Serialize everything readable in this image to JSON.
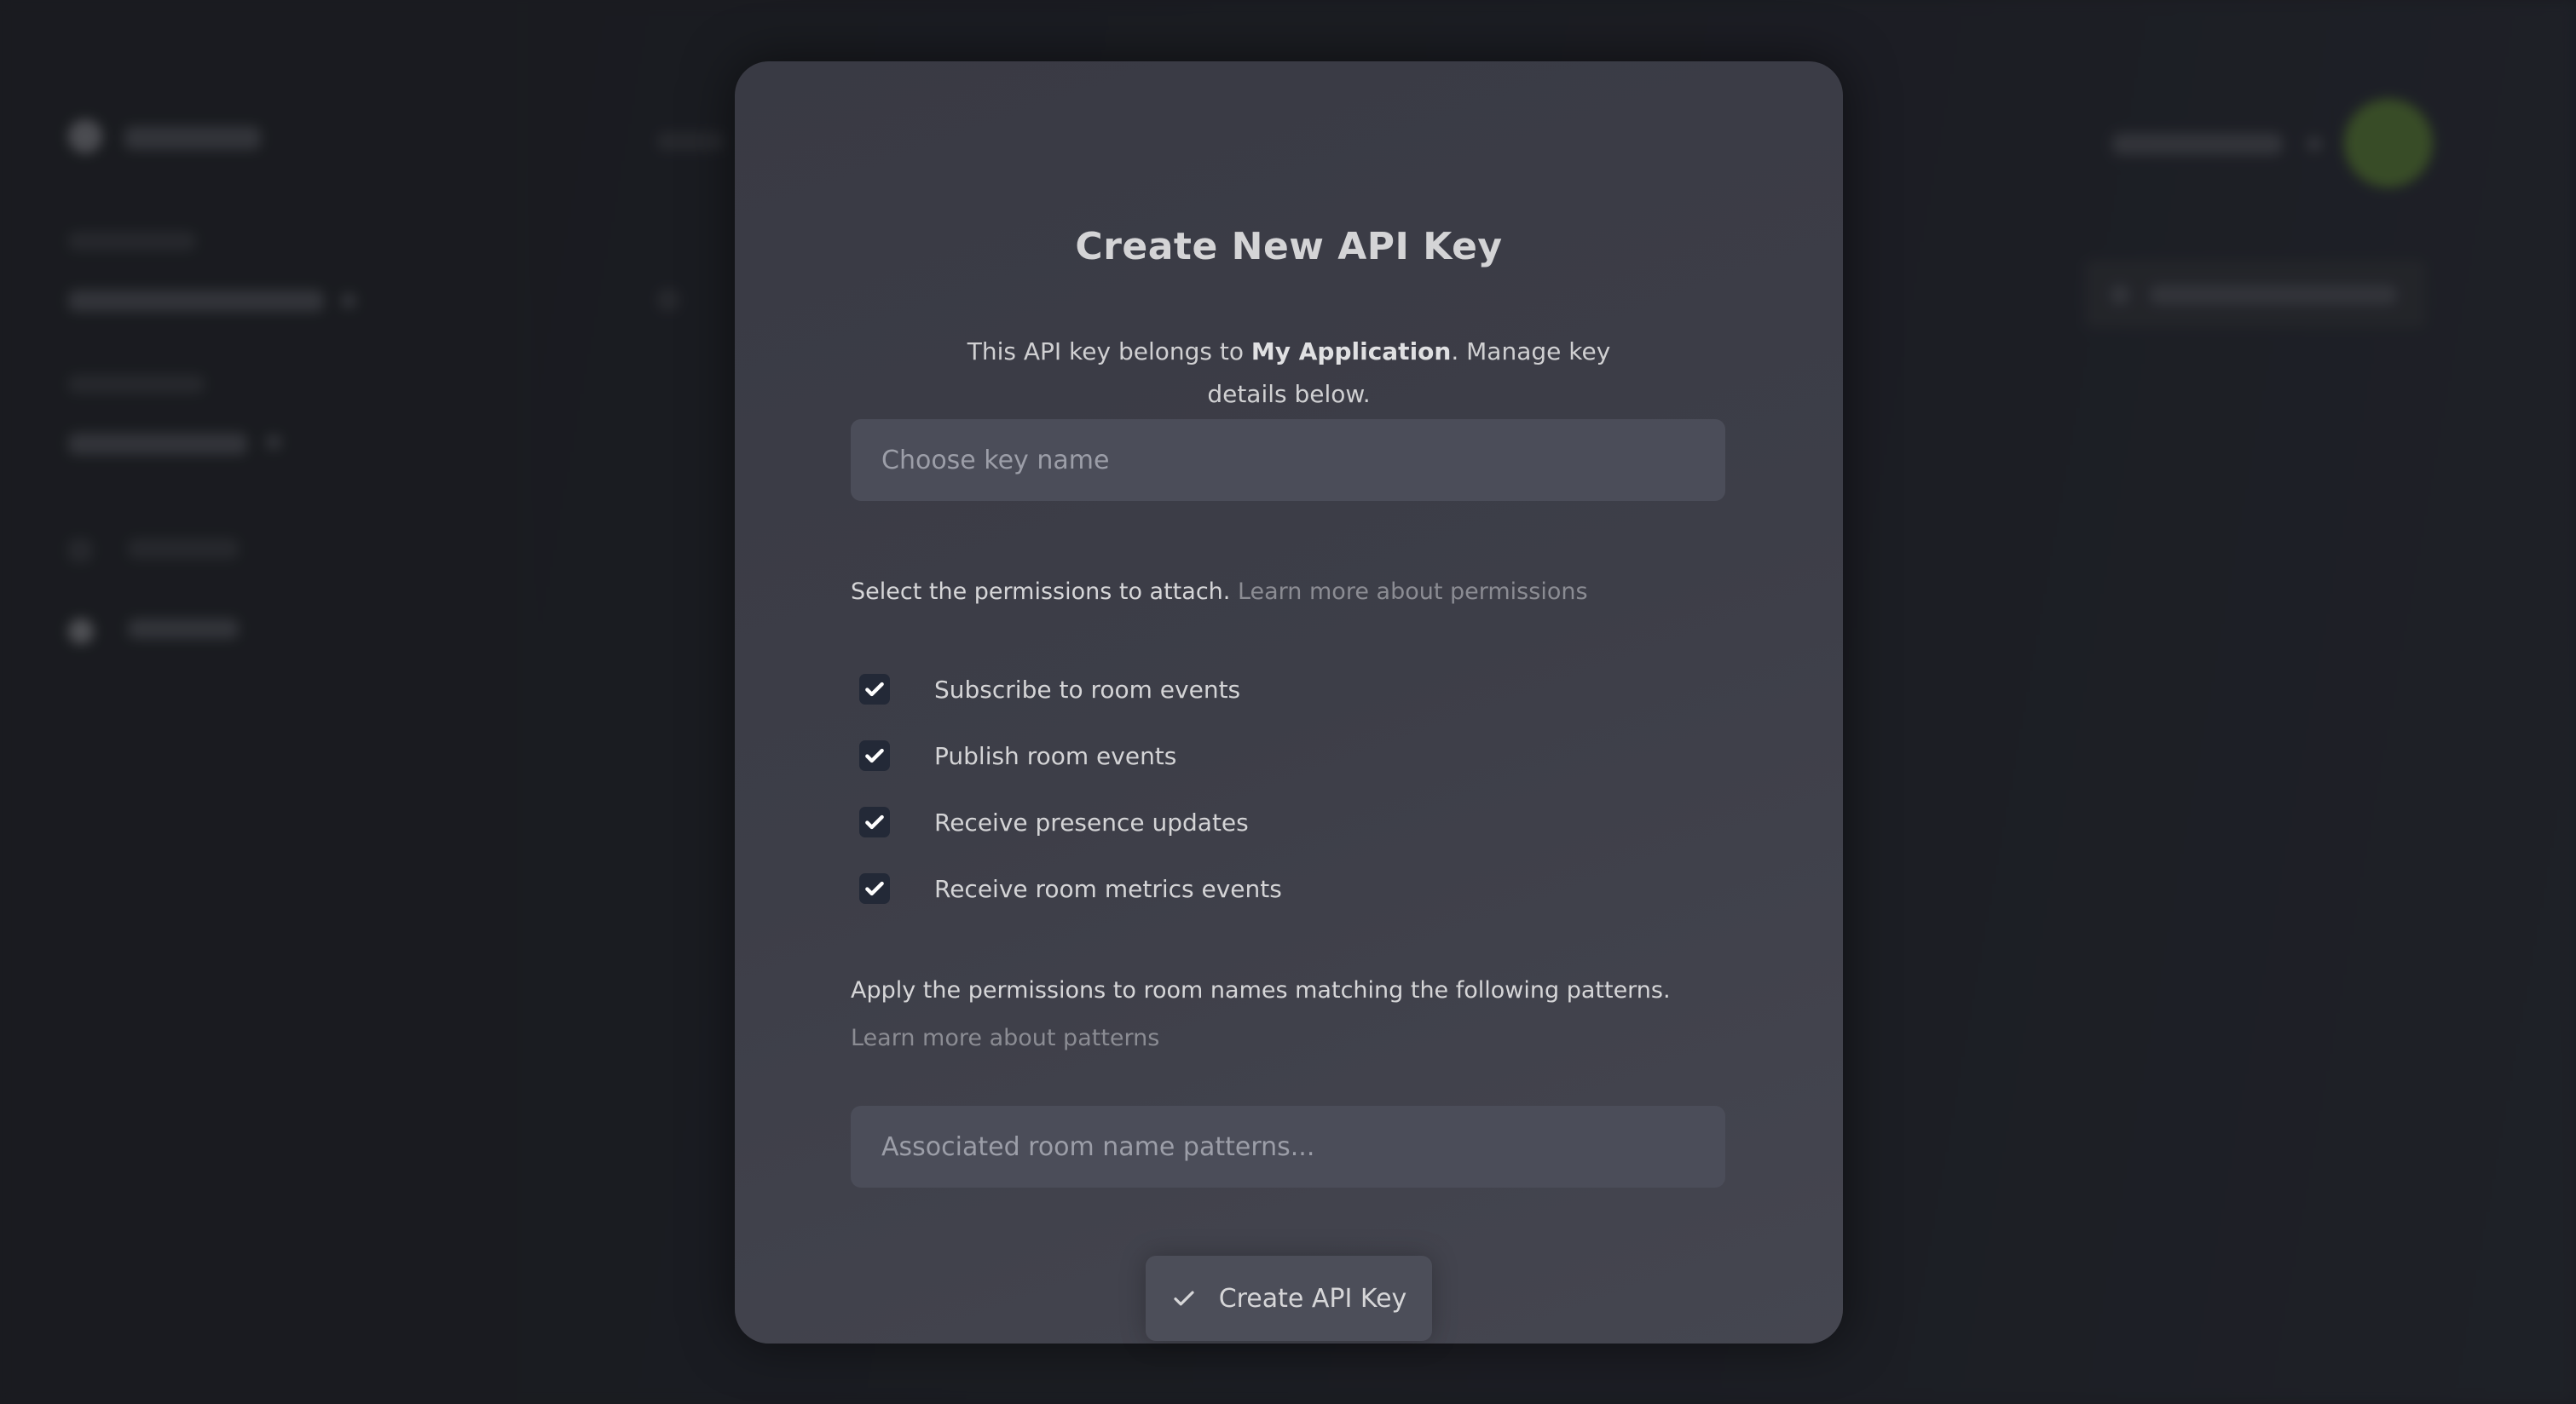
{
  "modal": {
    "title": "Create New API Key",
    "subtitle_prefix": "This API key belongs to ",
    "subtitle_app_name": "My Application",
    "subtitle_suffix": ". Manage key details below.",
    "key_name_placeholder": "Choose key name",
    "key_name_value": "",
    "permissions_intro": "Select the permissions to attach.",
    "permissions_link": "Learn more about permissions",
    "permissions": [
      {
        "label": "Subscribe to room events",
        "checked": true
      },
      {
        "label": "Publish room events",
        "checked": true
      },
      {
        "label": "Receive presence updates",
        "checked": true
      },
      {
        "label": "Receive room metrics events",
        "checked": true
      }
    ],
    "patterns_intro": "Apply the permissions to room names matching the following patterns.",
    "patterns_link": "Learn more about patterns",
    "patterns_placeholder": "Associated room name patterns...",
    "patterns_value": "",
    "submit_label": "Create API Key",
    "submit_icon": "check-icon"
  },
  "colors": {
    "avatar": "#4e6b30",
    "checkbox_fill": "#232937",
    "modal_bg": "#3d3e48",
    "input_bg": "#4b4d59",
    "link_muted": "#8b8c93"
  }
}
